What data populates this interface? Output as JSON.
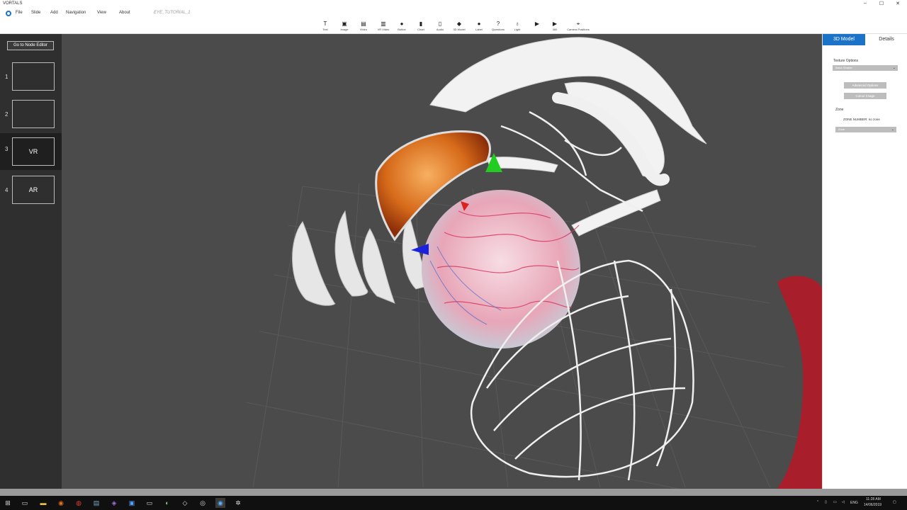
{
  "window": {
    "title": "VORTALS",
    "minimize": "–",
    "maximize": "☐",
    "close": "✕"
  },
  "menu": {
    "items": [
      "File",
      "Slide",
      "Add",
      "Navigation",
      "View",
      "About"
    ],
    "document_name": "EYE_TUTORIAL_1"
  },
  "toolbar": [
    {
      "label": "Text",
      "icon": "T"
    },
    {
      "label": "Image",
      "icon": "▣"
    },
    {
      "label": "Video",
      "icon": "▤"
    },
    {
      "label": "VR Video",
      "icon": "▥"
    },
    {
      "label": "Button",
      "icon": "●"
    },
    {
      "label": "Chart",
      "icon": "▮"
    },
    {
      "label": "Audio",
      "icon": "▯"
    },
    {
      "label": "3D Model",
      "icon": "◆"
    },
    {
      "label": "Label",
      "icon": "●"
    },
    {
      "label": "Questions",
      "icon": "?"
    },
    {
      "label": "Light",
      "icon": "♁"
    },
    {
      "label": "",
      "icon": "▶"
    },
    {
      "label": "360",
      "icon": "▶"
    },
    {
      "label": "Camera Positions",
      "icon": "⌖"
    }
  ],
  "left_panel": {
    "node_editor_label": "Go to Node Editor",
    "slides": [
      {
        "number": "1",
        "label": ""
      },
      {
        "number": "2",
        "label": ""
      },
      {
        "number": "3",
        "label": "VR"
      },
      {
        "number": "4",
        "label": "AR"
      }
    ]
  },
  "right_panel": {
    "tabs": [
      "3D Model",
      "Details"
    ],
    "texture_options_label": "Texture Options",
    "texture_select_value": "Basic Shader",
    "advanced_options_label": "Advanced Options",
    "colour_image_label": "Colour Image",
    "zone_label": "Zone",
    "zone_number_text": "ZONE NUMBER: no zone",
    "zone_select_value": "Zone"
  },
  "taskbar": {
    "time": "11:28 AM",
    "date": "14/06/2019",
    "lang": "ENG"
  }
}
